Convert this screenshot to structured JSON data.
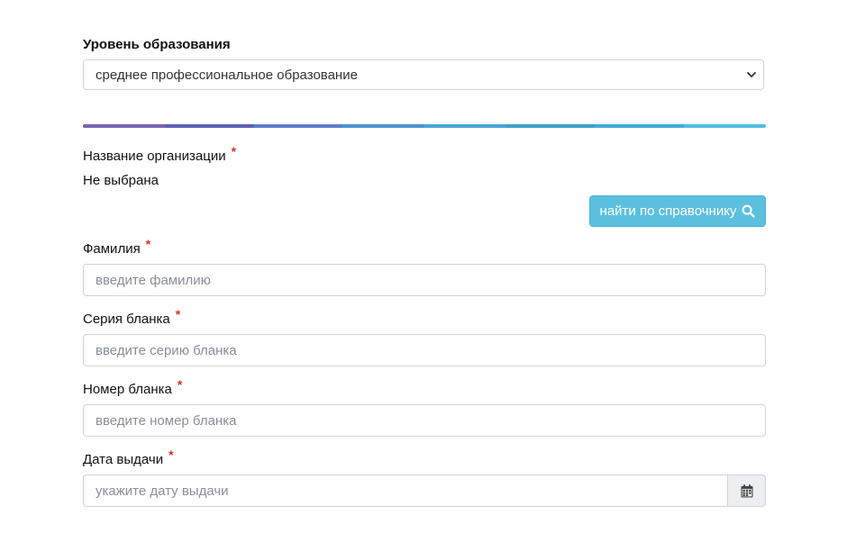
{
  "education": {
    "label": "Уровень образования",
    "selected": "среднее профессиональное образование"
  },
  "organization": {
    "label": "Название организации",
    "required_mark": "*",
    "value": "Не выбрана",
    "search_button": "найти по справочнику"
  },
  "surname": {
    "label": "Фамилия",
    "required_mark": "*",
    "placeholder": "введите фамилию"
  },
  "series": {
    "label": "Серия бланка",
    "required_mark": "*",
    "placeholder": "введите серию бланка"
  },
  "number": {
    "label": "Номер бланка",
    "required_mark": "*",
    "placeholder": "введите номер бланка"
  },
  "issue_date": {
    "label": "Дата выдачи",
    "required_mark": "*",
    "placeholder": "укажите дату выдачи"
  },
  "colors": {
    "accent": "#5bc0de",
    "required": "#d9302c"
  },
  "icons": [
    "chevron-down-icon",
    "search-icon",
    "calendar-icon"
  ]
}
